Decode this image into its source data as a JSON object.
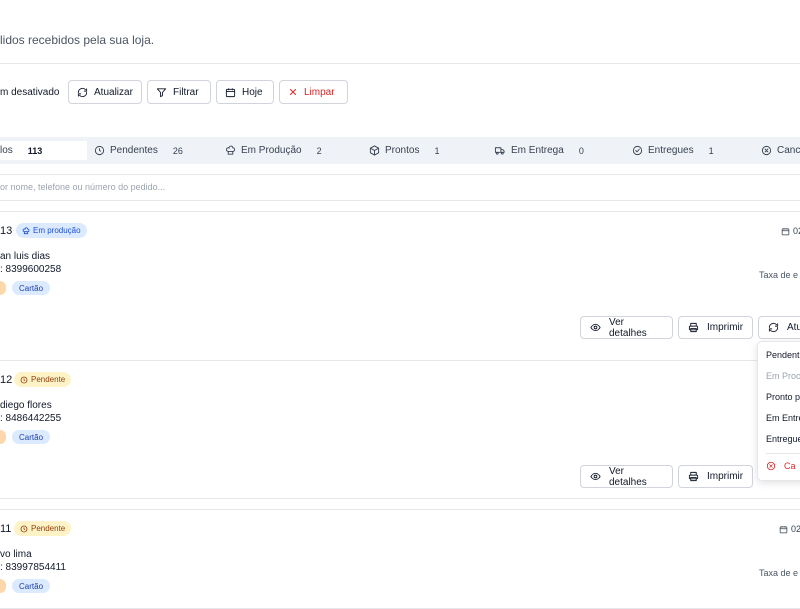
{
  "header": {
    "subtitle": "lidos recebidos pela sua loja."
  },
  "toolbar": {
    "toggle_label": "m desativado",
    "refresh_label": "Atualizar",
    "filter_label": "Filtrar",
    "today_label": "Hoje",
    "clear_label": "Limpar"
  },
  "tabs": [
    {
      "label": "los",
      "count": "113",
      "icon": "none",
      "active": true
    },
    {
      "label": "Pendentes",
      "count": "26",
      "icon": "clock-icon"
    },
    {
      "label": "Em Produção",
      "count": "2",
      "icon": "chef-hat-icon"
    },
    {
      "label": "Prontos",
      "count": "1",
      "icon": "package-icon"
    },
    {
      "label": "Em Entrega",
      "count": "0",
      "icon": "truck-icon"
    },
    {
      "label": "Entregues",
      "count": "1",
      "icon": "check-circle-icon"
    },
    {
      "label": "Canc",
      "count": "",
      "icon": "x-circle-icon"
    }
  ],
  "search": {
    "placeholder": "or nome, telefone ou número do pedido..."
  },
  "orders": [
    {
      "number": "13",
      "status": "Em produção",
      "status_type": "prod",
      "customer": "an luis dias",
      "phone": ": 8399600258",
      "payment": "Cartão",
      "date": "02",
      "fee": "Taxa de e"
    },
    {
      "number": "12",
      "status": "Pendente",
      "status_type": "pend",
      "customer": "diego flores",
      "phone": ": 8486442255",
      "payment": "Cartão",
      "date": "",
      "fee": ""
    },
    {
      "number": "11",
      "status": "Pendente",
      "status_type": "pend",
      "customer": "vo lima",
      "phone": ": 83997854411",
      "payment": "Cartão",
      "date": "02",
      "fee": "Taxa de e"
    }
  ],
  "actions": {
    "details_label": "Ver detalhes",
    "print_label": "Imprimir",
    "update_label": "Atu"
  },
  "status_menu": {
    "items": [
      "Pendent",
      "Em Proc",
      "Pronto p",
      "Em Entre",
      "Entregue",
      "Ca"
    ]
  },
  "colors": {
    "accent_red": "#dc2626",
    "tab_bar_bg": "#eff3f8",
    "badge_production": "#dbeafe",
    "badge_pending": "#fef3c7"
  }
}
